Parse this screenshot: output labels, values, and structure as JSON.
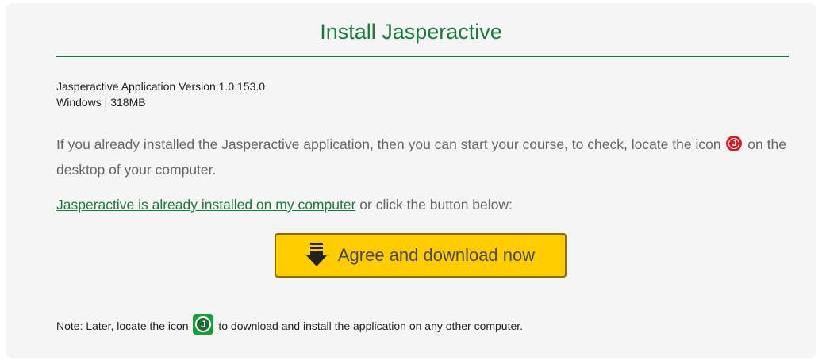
{
  "title": "Install Jasperactive",
  "version": {
    "line1": "Jasperactive Application Version 1.0.153.0",
    "line2": "Windows | 318MB"
  },
  "intro": {
    "before_icon": "If you already installed the Jasperactive application, then you can start your course, to check, locate the icon ",
    "icon_letter": "J",
    "after_icon": " on the desktop of your computer."
  },
  "installed": {
    "link_text": "Jasperactive is already installed on my computer",
    "suffix": " or click the button below:"
  },
  "download_button": {
    "label": "Agree and download now",
    "icon": "download-arrow-icon"
  },
  "note": {
    "before_icon": "Note: Later, locate the icon ",
    "icon_letter": "J",
    "after_icon": " to download and install the application on any other computer."
  },
  "colors": {
    "accent_green": "#1c7a3c",
    "button_yellow": "#ffcc00",
    "icon_red": "#d61f26",
    "icon_green": "#1a9e3a"
  }
}
